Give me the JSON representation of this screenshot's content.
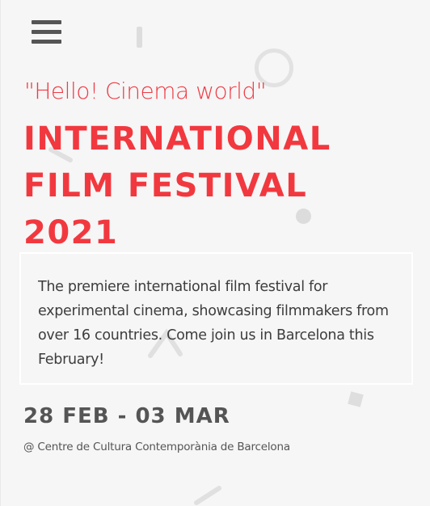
{
  "nav": {
    "menu_icon": "hamburger-menu-icon"
  },
  "hero": {
    "tagline": "\"Hello! Cinema world\"",
    "title_lines": [
      "INTERNATIONAL",
      "FILM FESTIVAL",
      "2021"
    ],
    "description": "The premiere international film festival for experimental cinema, showcasing filmmakers from over 16 countries. Come join us in Barcelona this February!",
    "dates": "28 FEB - 03 MAR",
    "venue": "@ Centre de Cultura Contemporània de Barcelona"
  },
  "colors": {
    "accent": "#f2383f",
    "text": "#3d3d3d",
    "muted": "#555555",
    "background": "#f6f6f6",
    "decoration": "#dddddd"
  }
}
